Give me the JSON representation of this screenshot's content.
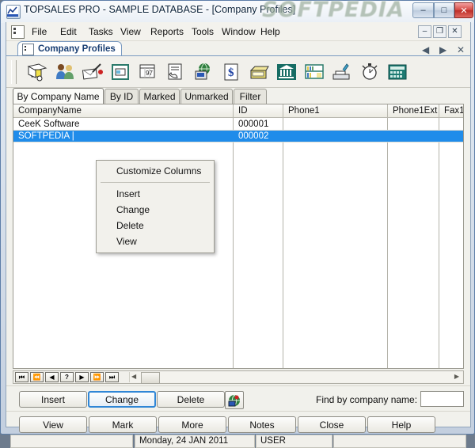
{
  "window": {
    "title": "TOPSALES PRO - SAMPLE DATABASE - [Company Profiles]",
    "watermark": "SOFTPEDIA",
    "app_icon": "topsales-icon",
    "buttons": {
      "minimize": "–",
      "maximize": "□",
      "close": "✕"
    },
    "accent_selection": "#1f8cea",
    "close_button_color": "#c4352d"
  },
  "menubar": {
    "items": [
      "File",
      "Edit",
      "Tasks",
      "View",
      "Reports",
      "Tools",
      "Window",
      "Help"
    ],
    "mdi_buttons": {
      "minimize": "–",
      "restore": "❐",
      "close": "✕"
    },
    "tab_nav": {
      "prev": "◀",
      "next": "▶",
      "close": "✕"
    }
  },
  "child_tab": {
    "label": "Company Profiles",
    "icon": "document-window-icon"
  },
  "toolbar": {
    "buttons": [
      {
        "name": "company-profiles-icon",
        "title": "Company Profiles"
      },
      {
        "name": "contacts-icon",
        "title": "Contacts"
      },
      {
        "name": "mail-merge-icon",
        "title": "Mail Merge"
      },
      {
        "name": "card-file-icon",
        "title": "Card File"
      },
      {
        "name": "calendar-icon",
        "title": "Calendar"
      },
      {
        "name": "phone-log-icon",
        "title": "Phone Log"
      },
      {
        "name": "web-icon",
        "title": "Web"
      },
      {
        "name": "invoice-icon",
        "title": "Invoices"
      },
      {
        "name": "cash-register-icon",
        "title": "Sales"
      },
      {
        "name": "bank-icon",
        "title": "Bank"
      },
      {
        "name": "library-icon",
        "title": "Library"
      },
      {
        "name": "scanner-icon",
        "title": "Scanner"
      },
      {
        "name": "timer-icon",
        "title": "Timer"
      },
      {
        "name": "calculator-icon",
        "title": "Calculator"
      }
    ]
  },
  "filter_tabs": [
    {
      "label": "By Company Name",
      "active": true
    },
    {
      "label": "By ID",
      "active": false
    },
    {
      "label": "Marked",
      "active": false
    },
    {
      "label": "Unmarked",
      "active": false
    },
    {
      "label": "Filter",
      "active": false
    }
  ],
  "grid": {
    "columns": [
      "CompanyName",
      "ID",
      "Phone1",
      "Phone1Ext",
      "Fax1"
    ],
    "rows": [
      {
        "CompanyName": "CeeK Software",
        "ID": "000001",
        "Phone1": "",
        "Phone1Ext": "",
        "Fax1": "",
        "selected": false
      },
      {
        "CompanyName": "SOFTPEDIA |",
        "ID": "000002",
        "Phone1": "",
        "Phone1Ext": "",
        "Fax1": "",
        "selected": true
      }
    ]
  },
  "context_menu": {
    "items": [
      {
        "label": "Customize Columns"
      },
      {
        "label": "Insert"
      },
      {
        "label": "Change"
      },
      {
        "label": "Delete"
      },
      {
        "label": "View"
      }
    ]
  },
  "nav_strip": {
    "buttons": [
      "⏮",
      "⏪",
      "◀",
      "?",
      "▶",
      "⏩",
      "⏭"
    ],
    "scroll_left": "◀",
    "scroll_right": "▶"
  },
  "action_buttons_row1": [
    {
      "label": "Insert",
      "accel": "I",
      "focus": false
    },
    {
      "label": "Change",
      "accel": "C",
      "focus": true
    },
    {
      "label": "Delete",
      "accel": "D",
      "focus": false
    }
  ],
  "globe_button": {
    "name": "globe-search-icon"
  },
  "find": {
    "label": "Find by company name:",
    "value": "",
    "placeholder": ""
  },
  "action_buttons_row2": [
    {
      "label": "View",
      "accel": "V",
      "focus": false
    },
    {
      "label": "Mark",
      "accel": "M",
      "focus": false
    },
    {
      "label": "More",
      "accel": "M",
      "focus": false
    },
    {
      "label": "Notes",
      "accel": "N",
      "focus": false
    },
    {
      "label": "Close",
      "accel": "",
      "focus": false
    },
    {
      "label": "Help",
      "accel": "H",
      "focus": false
    }
  ],
  "statusbar": {
    "panel1": "",
    "panel2": "Monday, 24 JAN 2011",
    "panel3": "USER",
    "panel4": ""
  }
}
